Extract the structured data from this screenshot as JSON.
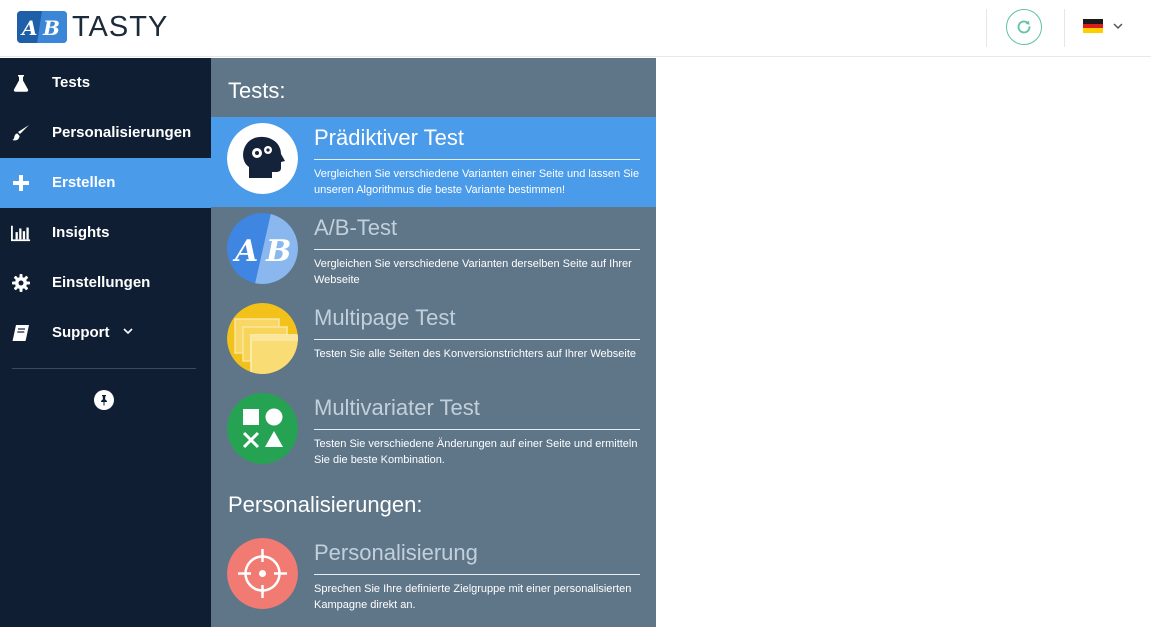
{
  "brand": {
    "logo_text": "TASTY",
    "accent": "#4a9bea",
    "sidebar_bg": "#0f1e33",
    "panel_bg": "#5f7689"
  },
  "header": {
    "refresh_icon": "refresh-icon",
    "language_flag": "german-flag-icon"
  },
  "sidebar": {
    "items": [
      {
        "label": "Tests",
        "icon": "flask-icon",
        "active": false
      },
      {
        "label": "Personalisierungen",
        "icon": "brush-icon",
        "active": false
      },
      {
        "label": "Erstellen",
        "icon": "plus-icon",
        "active": true
      },
      {
        "label": "Insights",
        "icon": "bar-chart-icon",
        "active": false
      },
      {
        "label": "Einstellungen",
        "icon": "gear-icon",
        "active": false
      },
      {
        "label": "Support",
        "icon": "book-icon",
        "active": false,
        "has_dropdown": true
      }
    ],
    "pin_icon": "pin-icon"
  },
  "panel": {
    "tests_heading": "Tests:",
    "tests": [
      {
        "title": "Prädiktiver Test",
        "desc": "Vergleichen Sie verschiedene Varianten einer Seite und lassen Sie unseren Algorithmus die beste Variante bestimmen!",
        "active": true,
        "icon": "brain-gears-icon",
        "icon_bg": "#ffffff"
      },
      {
        "title": "A/B-Test",
        "desc": "Vergleichen Sie verschiedene Varianten derselben Seite auf Ihrer Webseite",
        "active": false,
        "icon": "ab-letters-icon",
        "icon_bg": "#4a8ee6"
      },
      {
        "title": "Multipage Test",
        "desc": "Testen Sie alle Seiten des Konversionstrichters auf Ihrer Webseite",
        "active": false,
        "icon": "pages-stack-icon",
        "icon_bg": "#f3c419"
      },
      {
        "title": "Multivariater Test",
        "desc": "Testen Sie verschiedene Änderungen auf einer Seite und ermitteln Sie die beste Kombination.",
        "active": false,
        "icon": "shapes-icon",
        "icon_bg": "#26a352"
      }
    ],
    "personal_heading": "Personalisierungen:",
    "personalizations": [
      {
        "title": "Personalisierung",
        "desc": "Sprechen Sie Ihre definierte Zielgruppe mit einer personalisierten Kampagne direkt an.",
        "active": false,
        "icon": "crosshair-icon",
        "icon_bg": "#f07a72"
      }
    ]
  }
}
